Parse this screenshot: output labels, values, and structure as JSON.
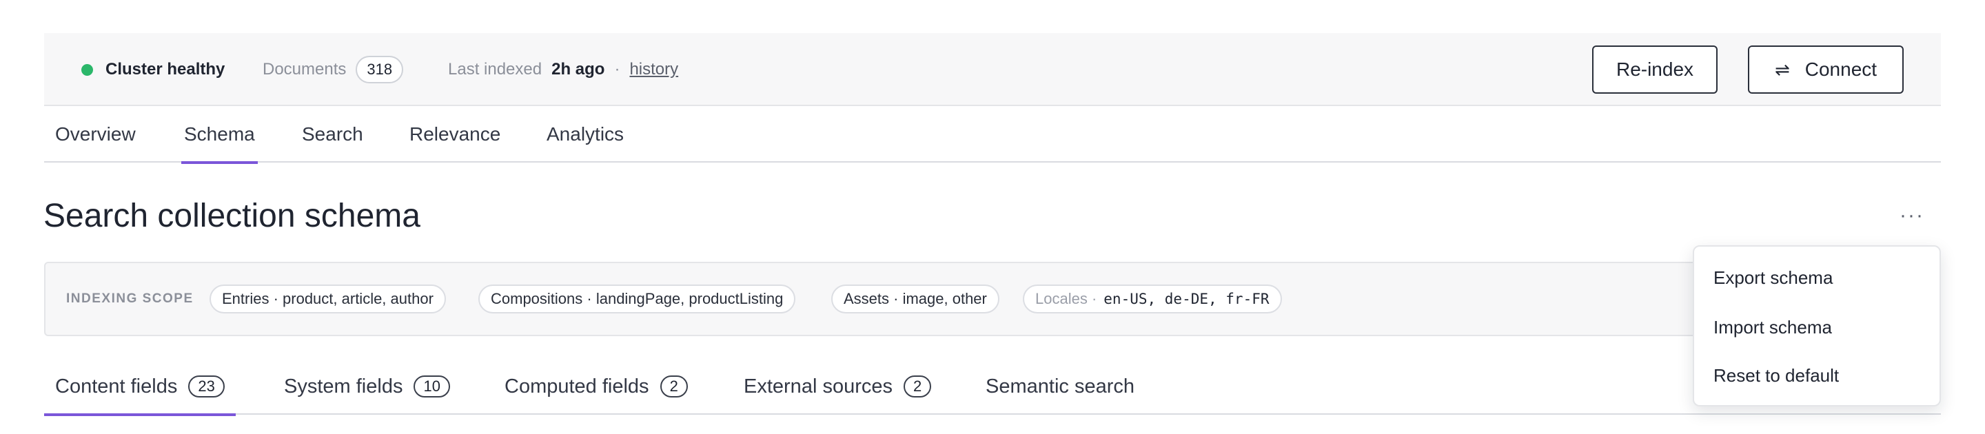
{
  "status": {
    "label": "Cluster healthy",
    "color": "#2bb76a"
  },
  "documents": {
    "label": "Documents",
    "count": "318"
  },
  "indexed": {
    "label": "Last indexed",
    "value": "2h ago",
    "separator": "·",
    "history_link": "history"
  },
  "actions": {
    "reindex_label": "Re-index",
    "connect_label": "Connect",
    "connect_icon": "⇌"
  },
  "nav": {
    "tabs": [
      "Overview",
      "Schema",
      "Search",
      "Relevance",
      "Analytics"
    ],
    "active": "Schema"
  },
  "page": {
    "title": "Search collection schema",
    "more_label": "···"
  },
  "scope": {
    "label": "INDEXING SCOPE",
    "chips": [
      "Entries · product, article, author",
      "Compositions · landingPage, productListing",
      "Assets · image, other"
    ],
    "locales_label": "Locales ·",
    "locales_value": "en-US, de-DE, fr-FR"
  },
  "subtabs": [
    {
      "label": "Content fields",
      "count": "23"
    },
    {
      "label": "System fields",
      "count": "10"
    },
    {
      "label": "Computed fields",
      "count": "2"
    },
    {
      "label": "External sources",
      "count": "2"
    },
    {
      "label": "Semantic search",
      "count": ""
    }
  ],
  "menu": {
    "items": [
      "Export schema",
      "Import schema",
      "Reset to default"
    ]
  },
  "accent": "#7b56d9"
}
